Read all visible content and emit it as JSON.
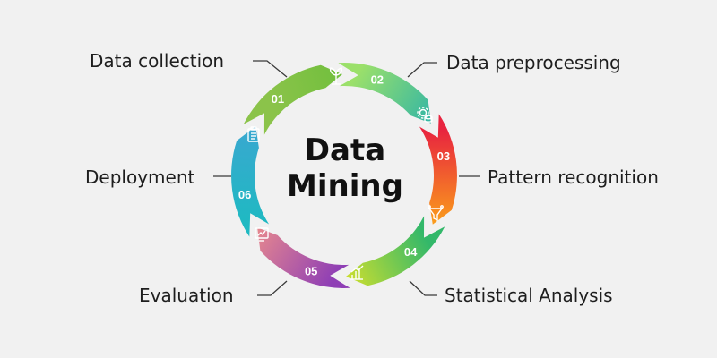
{
  "title": {
    "line1": "Data",
    "line2": "Mining"
  },
  "steps": [
    {
      "number": "01",
      "label": "Data collection",
      "color": "#7cc142",
      "icon": "plant-icon"
    },
    {
      "number": "02",
      "label": "Data preprocessing",
      "color": "#3cbf9b",
      "icon": "gear-database-icon"
    },
    {
      "number": "03",
      "label": "Pattern recognition",
      "color": "#f2512b",
      "icon": "funnel-icon"
    },
    {
      "number": "04",
      "label": "Statistical Analysis",
      "color": "#a9d02c",
      "icon": "bar-chart-icon"
    },
    {
      "number": "05",
      "label": "Evaluation",
      "color": "#cc4c86",
      "icon": "analytics-icon"
    },
    {
      "number": "06",
      "label": "Deployment",
      "color": "#2fb6c4",
      "icon": "clipboard-icon"
    }
  ]
}
